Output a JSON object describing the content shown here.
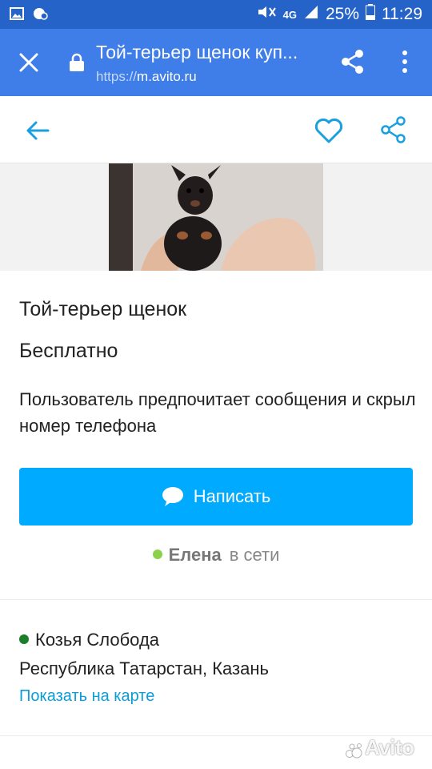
{
  "status_bar": {
    "icons_left": [
      "image-icon",
      "messenger-icon"
    ],
    "signal_label": "4G",
    "battery_percent": "25%",
    "time": "11:29"
  },
  "browser": {
    "tab_title": "Той-терьер щенок куп...",
    "url_scheme": "https://",
    "url_host": "m.avito.ru"
  },
  "listing": {
    "title": "Той-терьер щенок",
    "price": "Бесплатно",
    "contact_note": "Пользователь предпочитает сообщения и скрыл номер телефона",
    "write_button_label": "Написать",
    "seller_name": "Елена",
    "seller_status": "в сети",
    "metro_station": "Козья Слобода",
    "region_city": "Республика Татарстан, Казань",
    "map_link_label": "Показать на карте"
  },
  "watermark": "Avito",
  "colors": {
    "status_bar": "#2563c9",
    "browser_bar": "#3f7de8",
    "accent_button": "#00aaff",
    "link": "#0a9ed8",
    "online_dot": "#8cd04b",
    "metro_dot": "#1b7f2a"
  }
}
